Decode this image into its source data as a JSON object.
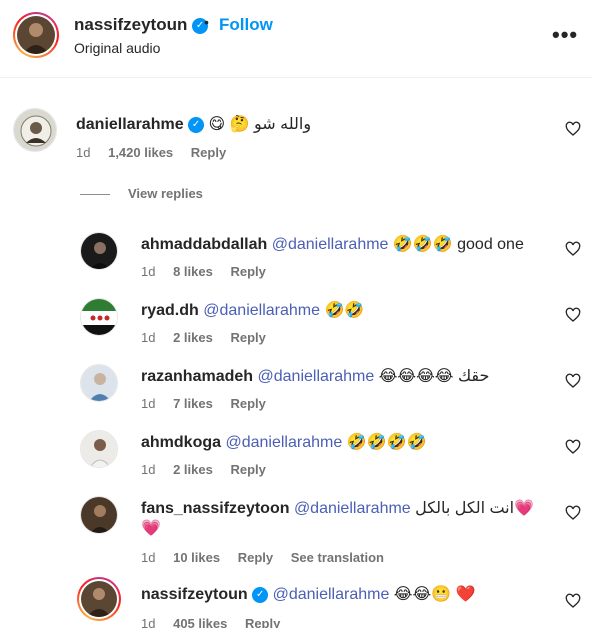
{
  "header": {
    "username": "nassifzeytoun",
    "verified_icon": "verified-badge-icon",
    "separator": "•",
    "follow_label": "Follow",
    "subtitle": "Original audio",
    "more_icon": "more-options-icon",
    "more_glyph": "•••"
  },
  "comments": [
    {
      "username": "daniellarahme",
      "mention": "",
      "text_after": "😋 🤔 والله شو",
      "age": "1d",
      "likes": "1,420 likes",
      "reply_label": "Reply"
    }
  ],
  "view_replies_label": "View replies",
  "replies": [
    {
      "username": "ahmaddabdallah",
      "mention": "@daniellarahme",
      "text": "🤣🤣🤣 good one",
      "age": "1d",
      "likes": "8 likes",
      "reply_label": "Reply"
    },
    {
      "username": "ryad.dh",
      "mention": "@daniellarahme",
      "text": "🤣🤣",
      "age": "1d",
      "likes": "2 likes",
      "reply_label": "Reply"
    },
    {
      "username": "razanhamadeh",
      "mention": "@daniellarahme",
      "text": "😂😂😂😂 حقك",
      "age": "1d",
      "likes": "7 likes",
      "reply_label": "Reply"
    },
    {
      "username": "ahmdkoga",
      "mention": "@daniellarahme",
      "text": "🤣🤣🤣🤣",
      "age": "1d",
      "likes": "2 likes",
      "reply_label": "Reply"
    },
    {
      "username": "fans_nassifzeytoon",
      "mention": "@daniellarahme",
      "text": "انت الكل بالكل💗",
      "text_line2": "💗",
      "age": "1d",
      "likes": "10 likes",
      "reply_label": "Reply",
      "translation_label": "See translation"
    },
    {
      "username": "nassifzeytoun",
      "mention": "@daniellarahme",
      "text": "😂😂😬 ❤️",
      "age": "1d",
      "likes": "405 likes",
      "reply_label": "Reply"
    }
  ],
  "icons": {
    "like": "heart-outline-icon",
    "verified": "verified-badge-icon"
  },
  "colors": {
    "link_blue": "#0095f6",
    "mention_blue": "#4a5fb5",
    "meta_gray": "#737373",
    "text": "#262626"
  }
}
